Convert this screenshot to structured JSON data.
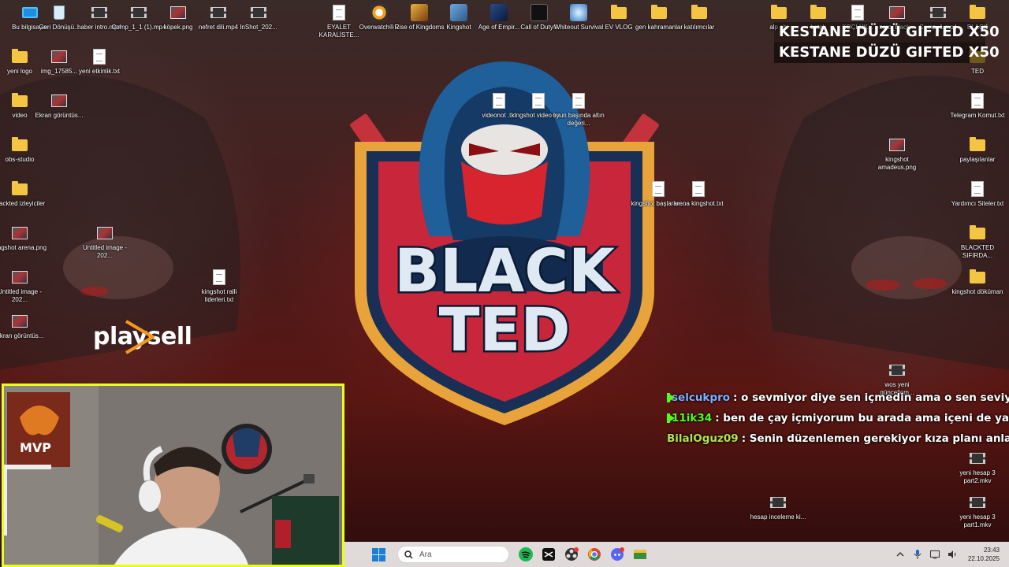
{
  "desktop_icons_left": [
    {
      "label": "Bu bilgisayar",
      "icon": "pc-icon"
    },
    {
      "label": "Geri Dönüşü...",
      "icon": "recycle-bin-icon"
    },
    {
      "label": "haber intro.mp4",
      "icon": "video-thumb-icon"
    },
    {
      "label": "Comp_1_1 (1).mp4",
      "icon": "video-thumb-icon"
    },
    {
      "label": "köpek.png",
      "icon": "image-thumb-icon"
    },
    {
      "label": "nefret dili.mp4",
      "icon": "video-thumb-icon"
    },
    {
      "label": "InShot_202...",
      "icon": "video-thumb-icon"
    },
    {
      "label": "yeni logo",
      "icon": "folder-icon"
    },
    {
      "label": "img_17585...",
      "icon": "image-thumb-icon"
    },
    {
      "label": "yeni etkinlik.txt",
      "icon": "text-file-icon"
    },
    {
      "label": "video",
      "icon": "folder-icon"
    },
    {
      "label": "Ekran görüntüs...",
      "icon": "image-thumb-icon"
    },
    {
      "label": "obs-studio",
      "icon": "folder-icon"
    },
    {
      "label": "blackted izleyiciler",
      "icon": "folder-icon"
    },
    {
      "label": "kingshot arena.png",
      "icon": "image-thumb-icon"
    },
    {
      "label": "Untitled image - 202...",
      "icon": "image-thumb-icon"
    },
    {
      "label": "kingshot ralli liderleri.txt",
      "icon": "text-file-icon"
    },
    {
      "label": "Untitled image - 202...",
      "icon": "image-thumb-icon"
    },
    {
      "label": "Ekran görüntüs...",
      "icon": "image-thumb-icon"
    }
  ],
  "desktop_icons_top": [
    {
      "label": "EYALET KARALİSTE...",
      "icon": "text-file-icon"
    },
    {
      "label": "Overwatch® 2",
      "icon": "overwatch-icon"
    },
    {
      "label": "Rise of Kingdoms",
      "icon": "rise-of-kingdoms-icon"
    },
    {
      "label": "Kingshot",
      "icon": "kingshot-icon"
    },
    {
      "label": "Age of Empir...",
      "icon": "age-of-empires-icon"
    },
    {
      "label": "Call of Duty®",
      "icon": "call-of-duty-icon"
    },
    {
      "label": "Whiteout Survival",
      "icon": "whiteout-survival-icon"
    },
    {
      "label": "EV VLOG",
      "icon": "folder-icon"
    },
    {
      "label": "gen kahramanlar",
      "icon": "folder-icon"
    },
    {
      "label": "katılımcılar",
      "icon": "folder-icon"
    }
  ],
  "desktop_icons_center": [
    {
      "label": "videonot .txt",
      "icon": "text-file-icon"
    },
    {
      "label": "kingshot video ko...",
      "icon": "text-file-icon"
    },
    {
      "label": "oyun başında altın değeri...",
      "icon": "text-file-icon"
    },
    {
      "label": "kingshot başlarke...",
      "icon": "text-file-icon"
    },
    {
      "label": "arena kingshot.txt",
      "icon": "text-file-icon"
    }
  ],
  "desktop_icons_right": [
    {
      "label": "alp abi",
      "icon": "folder-icon"
    },
    {
      "label": "batak",
      "icon": "folder-icon"
    },
    {
      "label": "KOÇLUK...",
      "icon": "text-file-icon"
    },
    {
      "label": "zero_black...",
      "icon": "image-thumb-icon"
    },
    {
      "label": "Comp_1.mp4",
      "icon": "video-thumb-icon"
    },
    {
      "label": "BLACK",
      "icon": "folder-icon"
    },
    {
      "label": "TED",
      "icon": "folder-icon"
    },
    {
      "label": "Telegram Komut.txt",
      "icon": "text-file-icon"
    },
    {
      "label": "kingshot amadeus.png",
      "icon": "image-thumb-icon"
    },
    {
      "label": "paylaşılanlar",
      "icon": "folder-icon"
    },
    {
      "label": "Yardımcı Siteler.txt",
      "icon": "text-file-icon"
    },
    {
      "label": "BLACKTED SIFIRDA...",
      "icon": "folder-icon"
    },
    {
      "label": "kingshot döküman",
      "icon": "folder-icon"
    },
    {
      "label": "wos yeni güncellem...",
      "icon": "video-thumb-icon"
    },
    {
      "label": "yeni hesap 3 part2.mkv",
      "icon": "video-thumb-icon"
    },
    {
      "label": "hesap inceleme ki...",
      "icon": "video-thumb-icon"
    },
    {
      "label": "yeni hesap 3 part1.mkv",
      "icon": "video-thumb-icon"
    }
  ],
  "wallpaper": {
    "logo_line1": "BLACK",
    "logo_line2": "TED",
    "brand": "playsell"
  },
  "gift_overlay": [
    "KESTANE DÜZÜ  GIFTED X50",
    "KESTANE DÜZÜ  GIFTED X50"
  ],
  "chat": [
    {
      "badge": "kick-icon",
      "user": "selcukpro",
      "user_color": "#7fb0ff",
      "message": ": o sevmiyor diye sen içmedin ama o sen seviyorsun o"
    },
    {
      "badge": "kick-icon",
      "user": "11ik34",
      "user_color": "#53fc18",
      "message": ": ben de çay içmiyorum bu arada ama içeni de yargılama"
    },
    {
      "badge": "",
      "user": "BilalOguz09",
      "user_color": "#b4e34a",
      "message": ": Senin düzenlemen gerekiyor kıza planı anlat"
    }
  ],
  "webcam": {
    "poster_text": "MVP",
    "border_color": "#e8ff1a"
  },
  "taskbar": {
    "search_placeholder": "Ara",
    "apps": [
      "spotify-icon",
      "capcut-icon",
      "obs-icon",
      "chrome-icon",
      "discord-icon",
      "whatsapp-like-icon"
    ],
    "time": "23:43",
    "date": "22.10.2025"
  }
}
